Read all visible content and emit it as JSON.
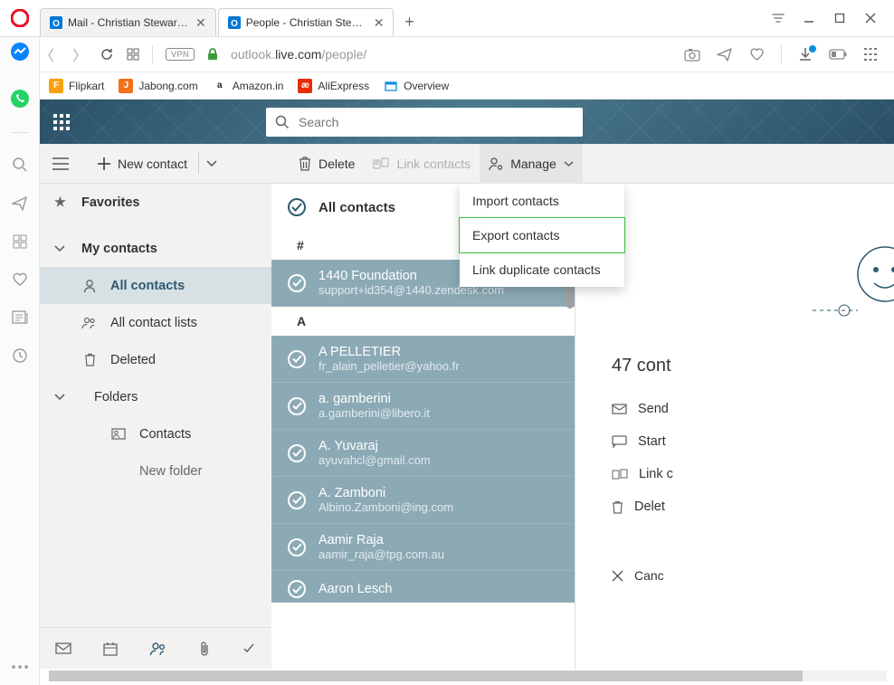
{
  "browser": {
    "tabs": [
      {
        "title": "Mail - Christian Stewart - O",
        "active": false
      },
      {
        "title": "People - Christian Stewart",
        "active": true
      }
    ],
    "url_prefix": "outlook.",
    "url_host": "live.com",
    "url_path": "/people/",
    "bookmarks": [
      {
        "label": "Flipkart",
        "color": "#f5a623"
      },
      {
        "label": "Jabong.com",
        "color": "#f5701b"
      },
      {
        "label": "Amazon.in",
        "color": "#222"
      },
      {
        "label": "AliExpress",
        "color": "#e62e04"
      },
      {
        "label": "Overview",
        "color": "#0b8de0"
      }
    ],
    "vpn_label": "VPN"
  },
  "outlook": {
    "search_placeholder": "Search",
    "commands": {
      "new_contact": "New contact",
      "delete": "Delete",
      "link_contacts": "Link contacts",
      "manage": "Manage"
    },
    "manage_menu": [
      "Import contacts",
      "Export contacts",
      "Link duplicate contacts"
    ],
    "nav": {
      "favorites": "Favorites",
      "my_contacts": "My contacts",
      "all_contacts": "All contacts",
      "all_contact_lists": "All contact lists",
      "deleted": "Deleted",
      "folders": "Folders",
      "contacts_folder": "Contacts",
      "new_folder": "New folder"
    },
    "list_header": "All contacts",
    "sections": [
      {
        "letter": "#",
        "items": [
          {
            "name": "1440 Foundation",
            "email": "support+id354@1440.zendesk.com"
          }
        ]
      },
      {
        "letter": "A",
        "items": [
          {
            "name": "A PELLETIER",
            "email": "fr_alain_pelletier@yahoo.fr"
          },
          {
            "name": "a. gamberini",
            "email": "a.gamberini@libero.it"
          },
          {
            "name": "A. Yuvaraj",
            "email": "ayuvahcl@gmail.com"
          },
          {
            "name": "A. Zamboni",
            "email": "Albino.Zamboni@ing.com"
          },
          {
            "name": "Aamir Raja",
            "email": "aamir_raja@tpg.com.au"
          },
          {
            "name": "Aaron Lesch",
            "email": ""
          }
        ]
      }
    ],
    "detail": {
      "title": "47 cont",
      "actions": {
        "send": "Send",
        "start": "Start",
        "link": "Link c",
        "delete": "Delet",
        "cancel": "Canc"
      }
    }
  }
}
